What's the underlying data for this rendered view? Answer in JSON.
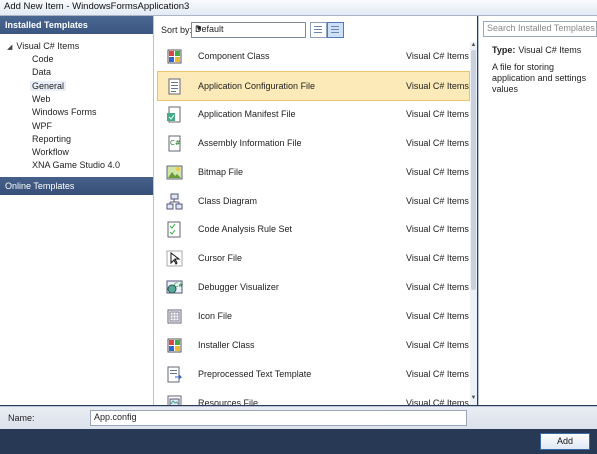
{
  "window": {
    "title": "Add New Item - WindowsFormsApplication3"
  },
  "left": {
    "header": "Installed Templates",
    "root": "Visual C# Items",
    "items": [
      "Code",
      "Data",
      "General",
      "Web",
      "Windows Forms",
      "WPF",
      "Reporting",
      "Workflow",
      "XNA Game Studio 4.0"
    ],
    "selected": "General",
    "online": "Online Templates"
  },
  "toolbar": {
    "sort_label": "Sort by:",
    "sort_value": "Default"
  },
  "templates": [
    {
      "name": "Component Class",
      "category": "Visual C# Items",
      "icon": "component-class-icon"
    },
    {
      "name": "Application Configuration File",
      "category": "Visual C# Items",
      "icon": "config-file-icon"
    },
    {
      "name": "Application Manifest File",
      "category": "Visual C# Items",
      "icon": "manifest-file-icon"
    },
    {
      "name": "Assembly Information File",
      "category": "Visual C# Items",
      "icon": "assembly-info-icon"
    },
    {
      "name": "Bitmap File",
      "category": "Visual C# Items",
      "icon": "bitmap-file-icon"
    },
    {
      "name": "Class Diagram",
      "category": "Visual C# Items",
      "icon": "class-diagram-icon"
    },
    {
      "name": "Code Analysis Rule Set",
      "category": "Visual C# Items",
      "icon": "rule-set-icon"
    },
    {
      "name": "Cursor File",
      "category": "Visual C# Items",
      "icon": "cursor-file-icon"
    },
    {
      "name": "Debugger Visualizer",
      "category": "Visual C# Items",
      "icon": "debugger-visualizer-icon"
    },
    {
      "name": "Icon File",
      "category": "Visual C# Items",
      "icon": "icon-file-icon"
    },
    {
      "name": "Installer Class",
      "category": "Visual C# Items",
      "icon": "installer-class-icon"
    },
    {
      "name": "Preprocessed Text Template",
      "category": "Visual C# Items",
      "icon": "text-template-icon"
    },
    {
      "name": "Resources File",
      "category": "Visual C# Items",
      "icon": "resources-file-icon"
    }
  ],
  "selected_template": "Application Configuration File",
  "right": {
    "search_placeholder": "Search Installed Templates",
    "type_label": "Type:",
    "type_value": "Visual C# Items",
    "description": "A file for storing application and settings values"
  },
  "bottom": {
    "name_label": "Name:",
    "name_value": "App.config",
    "add_label": "Add"
  }
}
